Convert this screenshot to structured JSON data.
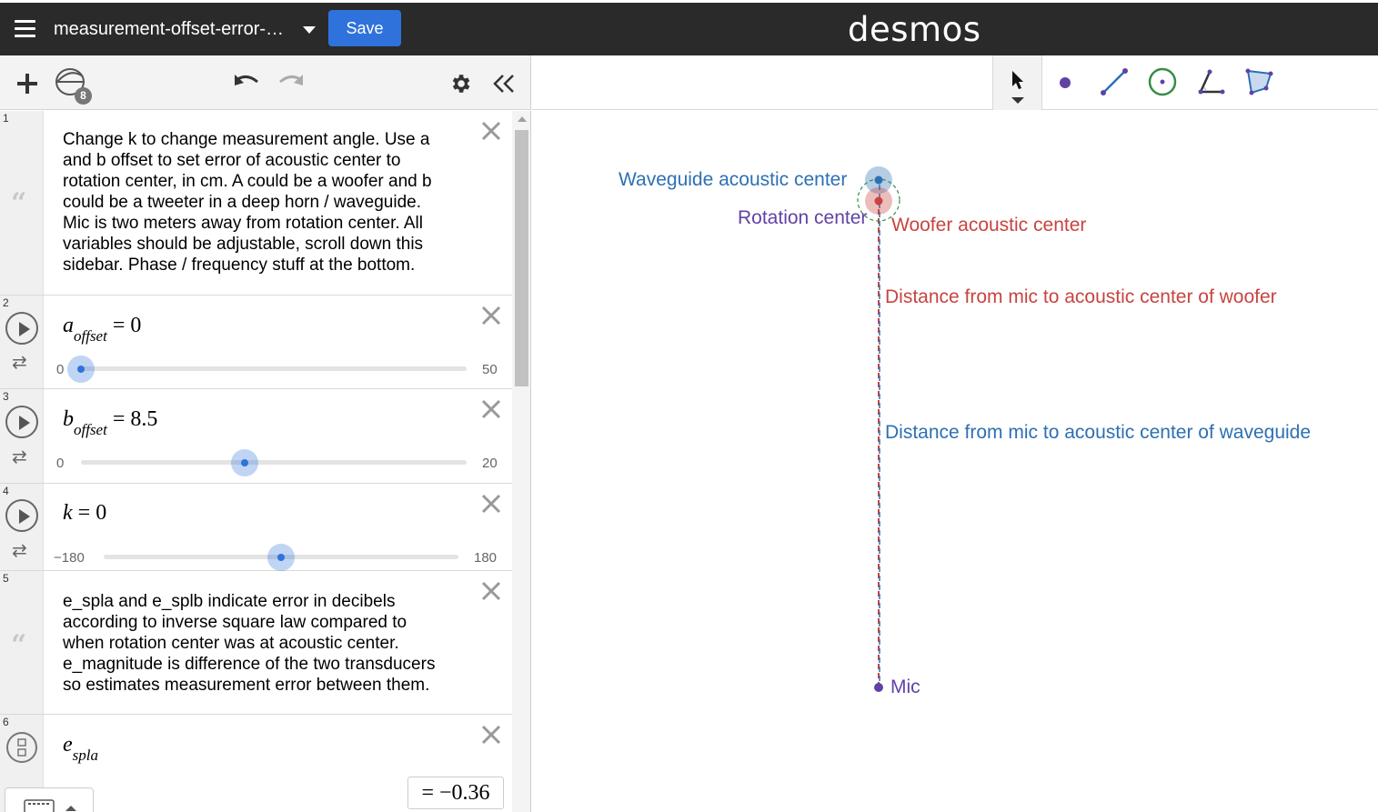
{
  "header": {
    "title": "measurement-offset-error-…",
    "save_label": "Save",
    "logo": "desmos"
  },
  "toolbar": {
    "graph_count": "8"
  },
  "expressions": [
    {
      "index": "1",
      "type": "note",
      "lines": [
        "Change k to change measurement angle. Use a",
        "and b offset to set error of acoustic center to",
        "rotation center, in cm. A could be a woofer and b",
        "could be a tweeter in a deep horn / waveguide.",
        "Mic is two meters away from rotation center. All",
        "variables should be adjustable, scroll down this",
        "sidebar. Phase / frequency stuff at the bottom."
      ]
    },
    {
      "index": "2",
      "type": "slider",
      "var": "a",
      "sub": "offset",
      "eq": "= 0",
      "min": "0",
      "max": "50",
      "value": 0,
      "range": [
        0,
        50
      ]
    },
    {
      "index": "3",
      "type": "slider",
      "var": "b",
      "sub": "offset",
      "eq": "= 8.5",
      "min": "0",
      "max": "20",
      "value": 8.5,
      "range": [
        0,
        20
      ]
    },
    {
      "index": "4",
      "type": "slider",
      "var": "k",
      "sub": "",
      "eq": "= 0",
      "min": "−180",
      "max": "180",
      "value": 0,
      "range": [
        -180,
        180
      ]
    },
    {
      "index": "5",
      "type": "note",
      "lines": [
        "e_spla and e_splb indicate error in decibels",
        "according to inverse square law compared to",
        "when rotation center was at acoustic center.",
        "e_magnitude is difference of the two transducers",
        "so estimates measurement error between them."
      ]
    },
    {
      "index": "6",
      "type": "expression",
      "var": "e",
      "sub": "spla",
      "result": "= −0.36"
    }
  ],
  "graph": {
    "labels": {
      "waveguide": "Waveguide acoustic center",
      "rotation": "Rotation center",
      "woofer": "Woofer acoustic center",
      "dist_woofer": "Distance from mic to acoustic center of woofer",
      "dist_waveguide": "Distance from mic to acoustic center of waveguide",
      "mic": "Mic"
    },
    "colors": {
      "blue": "#2d70b3",
      "red": "#c74440",
      "purple": "#6042a6"
    }
  },
  "icons": {
    "menu": "hamburger-icon",
    "add": "plus-icon",
    "graphs": "graph-stack-icon",
    "undo": "undo-icon",
    "redo": "redo-icon",
    "settings": "gear-icon",
    "collapse": "double-chevron-left-icon",
    "delete": "close-icon",
    "play": "play-icon",
    "loop": "loop-icon",
    "keyboard": "keyboard-icon"
  }
}
